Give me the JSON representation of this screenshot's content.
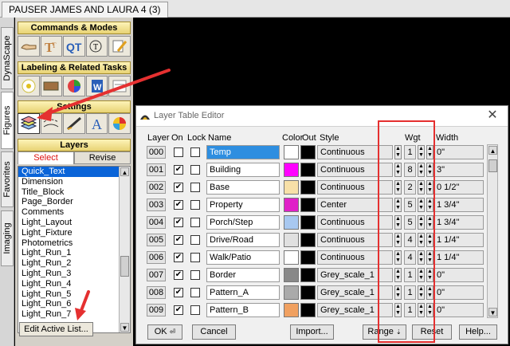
{
  "window": {
    "title": "PAUSER JAMES AND LAURA 4 (3)"
  },
  "side_tabs": [
    "DynaScape",
    "Figures",
    "Favorites",
    "Imaging"
  ],
  "palette": {
    "sections": {
      "commands": "Commands & Modes",
      "labeling": "Labeling & Related Tasks",
      "settings": "Settings",
      "layers": "Layers"
    },
    "layer_tabs": {
      "select": "Select",
      "revise": "Revise"
    },
    "layer_list": [
      "Quick_Text",
      "Dimension",
      "Title_Block",
      "Page_Border",
      "Comments",
      "Light_Layout",
      "Light_Fixture",
      "Photometrics",
      "Light_Run_1",
      "Light_Run_2",
      "Light_Run_3",
      "Light_Run_4",
      "Light_Run_5",
      "Light_Run_6",
      "Light_Run_7"
    ],
    "edit_button": "Edit Active List..."
  },
  "dialog": {
    "title": "Layer Table Editor",
    "headers": {
      "layer": "Layer",
      "on": "On",
      "lock": "Lock",
      "name": "Name",
      "color": "Color",
      "out": "Out",
      "style": "Style",
      "wgt": "Wgt",
      "width": "Width"
    },
    "rows": [
      {
        "num": "000",
        "on": false,
        "lock": false,
        "name": "Temp",
        "color": "#ffffff",
        "style": "Continuous",
        "wgt": "1",
        "width": "0\""
      },
      {
        "num": "001",
        "on": true,
        "lock": false,
        "name": "Building",
        "color": "#ff00ff",
        "style": "Continuous",
        "wgt": "8",
        "width": "3\""
      },
      {
        "num": "002",
        "on": true,
        "lock": false,
        "name": "Base",
        "color": "#f7e0a8",
        "style": "Continuous",
        "wgt": "2",
        "width": "0 1/2\""
      },
      {
        "num": "003",
        "on": true,
        "lock": false,
        "name": "Property",
        "color": "#e020c8",
        "style": "Center",
        "wgt": "5",
        "width": "1 3/4\""
      },
      {
        "num": "004",
        "on": true,
        "lock": false,
        "name": "Porch/Step",
        "color": "#a8c8f0",
        "style": "Continuous",
        "wgt": "5",
        "width": "1 3/4\""
      },
      {
        "num": "005",
        "on": true,
        "lock": false,
        "name": "Drive/Road",
        "color": "#e0e0e0",
        "style": "Continuous",
        "wgt": "4",
        "width": "1 1/4\""
      },
      {
        "num": "006",
        "on": true,
        "lock": false,
        "name": "Walk/Patio",
        "color": "#ffffff",
        "style": "Continuous",
        "wgt": "4",
        "width": "1 1/4\""
      },
      {
        "num": "007",
        "on": true,
        "lock": false,
        "name": "Border",
        "color": "#888888",
        "style": "Grey_scale_1",
        "wgt": "1",
        "width": "0\""
      },
      {
        "num": "008",
        "on": true,
        "lock": false,
        "name": "Pattern_A",
        "color": "#aaaaaa",
        "style": "Grey_scale_1",
        "wgt": "1",
        "width": "0\""
      },
      {
        "num": "009",
        "on": true,
        "lock": false,
        "name": "Pattern_B",
        "color": "#f0a060",
        "style": "Grey_scale_1",
        "wgt": "1",
        "width": "0\""
      }
    ],
    "buttons": {
      "ok": "OK",
      "cancel": "Cancel",
      "import": "Import...",
      "range": "Range",
      "reset": "Reset",
      "help": "Help..."
    }
  },
  "colors": {
    "annotation": "#e53030",
    "selection": "#0a64d8",
    "section_gold": "#e8d374"
  }
}
